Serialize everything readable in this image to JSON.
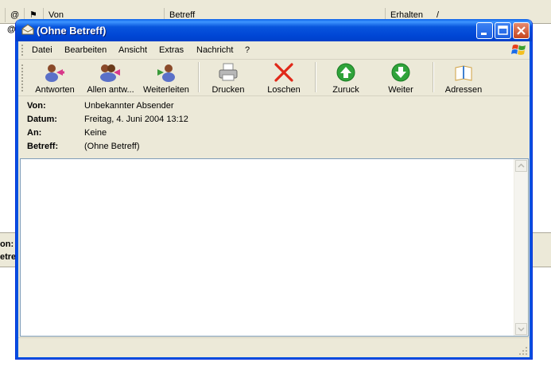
{
  "background_app": {
    "columns": [
      {
        "id": "attach",
        "label": "@"
      },
      {
        "id": "flag",
        "label": "⚑"
      },
      {
        "id": "from",
        "label": "Von"
      },
      {
        "id": "subject",
        "label": "Betreff"
      },
      {
        "id": "received",
        "label": "Erhalten"
      }
    ],
    "sort_indicator": "/",
    "row_glyph": "@",
    "lower_labels": [
      "on:",
      "etre"
    ]
  },
  "window": {
    "title": "(Ohne Betreff)",
    "title_bar_color": "#0a54e0"
  },
  "menu": {
    "items": [
      "Datei",
      "Bearbeiten",
      "Ansicht",
      "Extras",
      "Nachricht",
      "?"
    ]
  },
  "toolbar": {
    "buttons": [
      {
        "label": "Antworten",
        "icon": "reply-icon"
      },
      {
        "label": "Allen antw...",
        "icon": "reply-all-icon"
      },
      {
        "label": "Weiterleiten",
        "icon": "forward-icon"
      },
      {
        "label": "Drucken",
        "icon": "printer-icon"
      },
      {
        "label": "Loschen",
        "icon": "delete-icon"
      },
      {
        "label": "Zuruck",
        "icon": "arrow-up-icon"
      },
      {
        "label": "Weiter",
        "icon": "arrow-down-icon"
      },
      {
        "label": "Adressen",
        "icon": "address-book-icon"
      }
    ]
  },
  "message_header": {
    "from_label": "Von:",
    "from_value": "Unbekannter Absender",
    "date_label": "Datum:",
    "date_value": "Freitag, 4. Juni 2004 13:12",
    "to_label": "An:",
    "to_value": "Keine",
    "subject_label": "Betreff:",
    "subject_value": "(Ohne Betreff)"
  },
  "colors": {
    "window_face": "#ece9d8",
    "border_blue": "#0050e0",
    "close_red": "#c6461e",
    "arrow_green": "#2fa33a"
  }
}
